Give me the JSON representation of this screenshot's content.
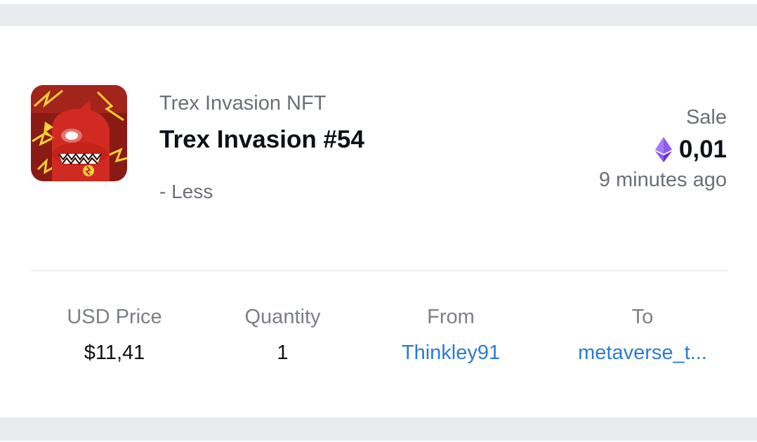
{
  "nft": {
    "collection": "Trex Invasion NFT",
    "name": "Trex Invasion #54",
    "toggle_label": "- Less"
  },
  "event": {
    "type": "Sale",
    "price": "0,01",
    "currency_icon": "ethereum-icon",
    "time_ago": "9 minutes ago"
  },
  "details": {
    "usd_price_label": "USD Price",
    "usd_price_value": "$11,41",
    "quantity_label": "Quantity",
    "quantity_value": "1",
    "from_label": "From",
    "from_value": "Thinkley91",
    "to_label": "To",
    "to_value": "metaverse_t..."
  },
  "colors": {
    "link": "#2b7cd3",
    "muted_text": "#6b6f76",
    "primary_text": "#0d1015",
    "eth_purple": "#7b3fe4",
    "page_bg": "#e8eaee"
  }
}
